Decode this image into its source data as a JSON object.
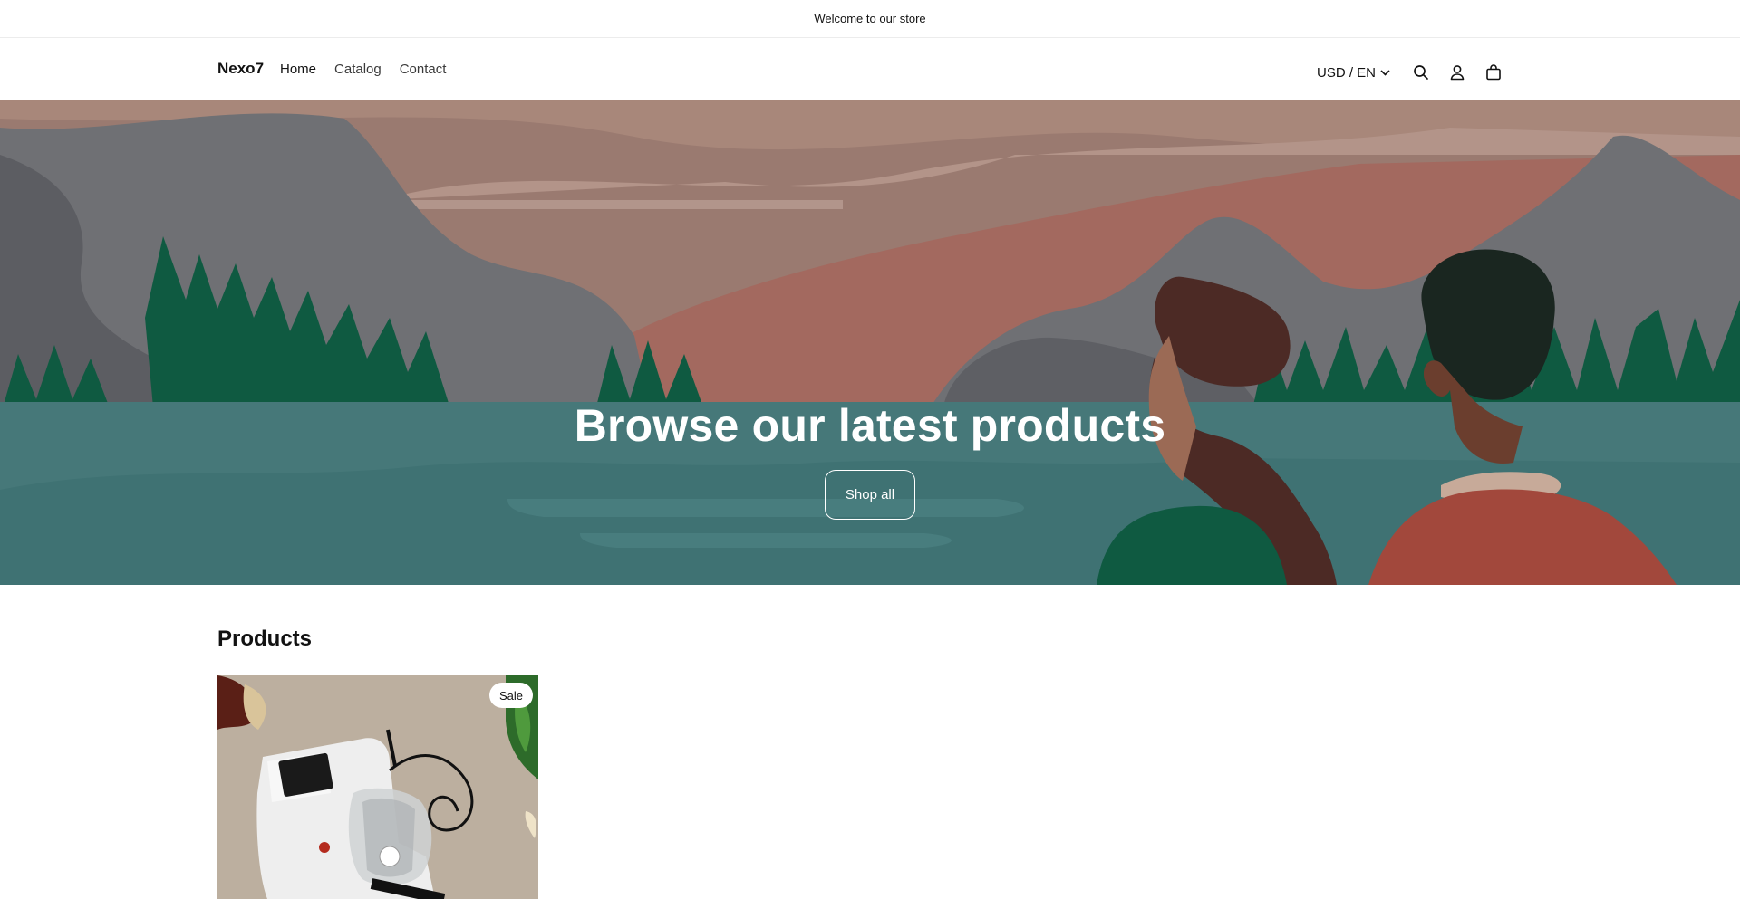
{
  "announcement": {
    "text": "Welcome to our store"
  },
  "header": {
    "brand": "Nexo7",
    "nav": [
      {
        "label": "Home"
      },
      {
        "label": "Catalog"
      },
      {
        "label": "Contact"
      }
    ],
    "locale": "USD / EN",
    "icons": [
      "search-icon",
      "account-icon",
      "cart-icon"
    ]
  },
  "hero": {
    "title": "Browse our latest products",
    "button_label": "Shop all"
  },
  "products": {
    "heading": "Products",
    "items": [
      {
        "badge": "Sale",
        "image": "knife-sharpener-product-image"
      }
    ]
  },
  "colors": {
    "water": "#467879",
    "forest": "#0f5a41",
    "sky": "#9a7a70"
  }
}
